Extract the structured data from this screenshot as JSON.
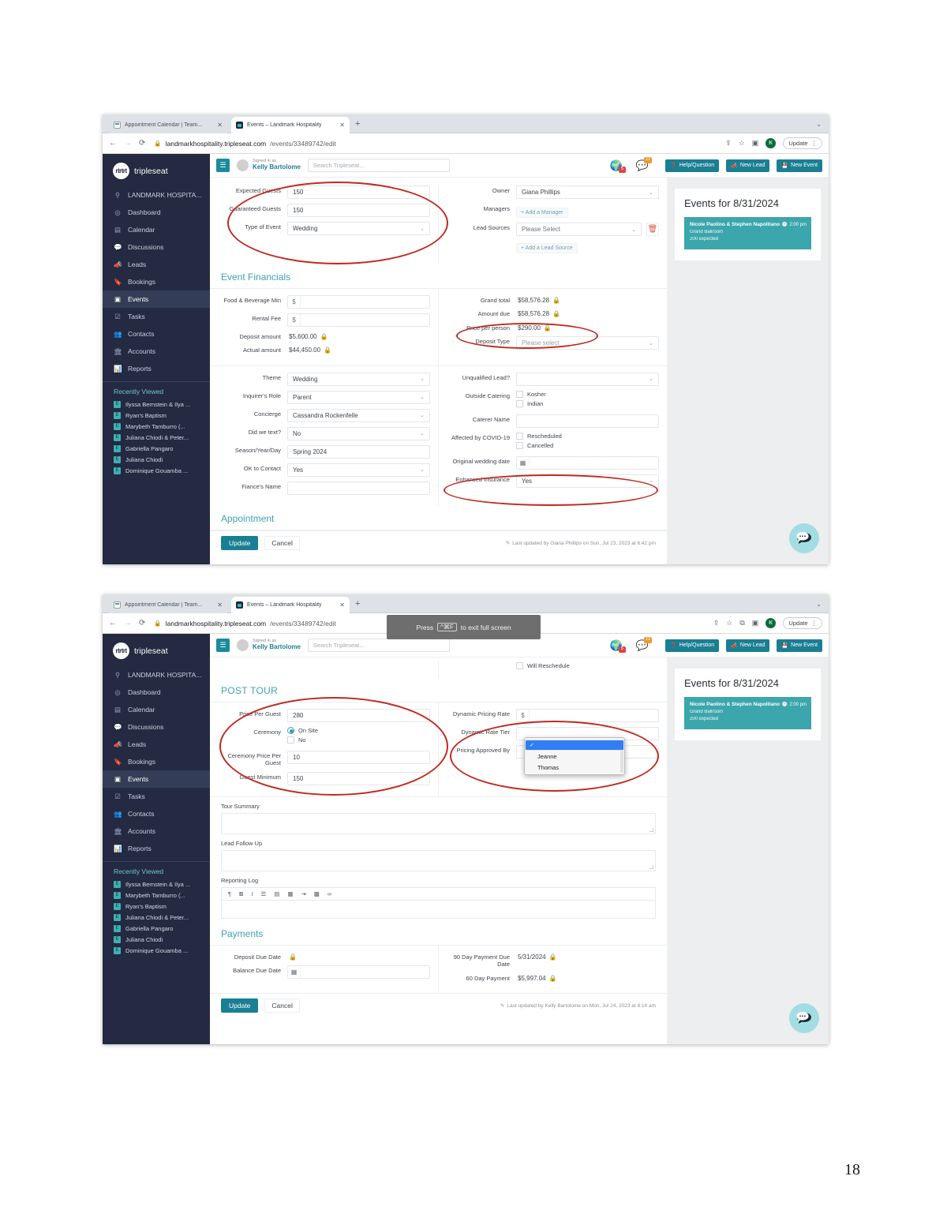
{
  "page": {
    "number": "18"
  },
  "browser": {
    "tabs": [
      {
        "label": "Appointment Calendar | Team...",
        "close": "✕",
        "icon": "calendar-favicon"
      },
      {
        "label": "Events – Landmark Hospitality",
        "close": "✕",
        "icon": "tripleseat-favicon"
      }
    ],
    "new_tab": "+",
    "back": "←",
    "forward": "→",
    "reload": "⟳",
    "lock": "🔒",
    "url_host": "landmarkhospitality.tripleseat.com",
    "url_path": "/events/33489742/edit",
    "toolbar": {
      "share": "⇪",
      "bookmark": "☆",
      "sidepanel": "▣",
      "profile_initial": "K",
      "update_label": "Update",
      "kebab": "⋮"
    },
    "fullscreen_toast": {
      "pre": "Press",
      "key": "^⌘F",
      "post": "to exit full screen"
    }
  },
  "app": {
    "brand": {
      "mark": "rtrtrt",
      "name": "tripleseat"
    },
    "header": {
      "menu_icon": "☰",
      "signed_in_label": "Signed in as",
      "user_name": "Kelly Bartolome",
      "search_placeholder": "Search Tripleseat...",
      "globe_badge": "5",
      "chat_badge": "12",
      "buttons": [
        {
          "label": "Help/Question",
          "icon": "question-circle"
        },
        {
          "label": "New Lead",
          "icon": "megaphone"
        },
        {
          "label": "New Event",
          "icon": "save-disk"
        }
      ]
    },
    "sidebar": {
      "items": [
        {
          "label": "LANDMARK HOSPITA...",
          "icon": "location-pin",
          "active": false
        },
        {
          "label": "Dashboard",
          "icon": "gauge",
          "active": false
        },
        {
          "label": "Calendar",
          "icon": "calendar",
          "active": false
        },
        {
          "label": "Discussions",
          "icon": "chat",
          "active": false
        },
        {
          "label": "Leads",
          "icon": "megaphone",
          "active": false
        },
        {
          "label": "Bookings",
          "icon": "bookmark",
          "active": false
        },
        {
          "label": "Events",
          "icon": "event-card",
          "active": true
        },
        {
          "label": "Tasks",
          "icon": "check-square",
          "active": false
        },
        {
          "label": "Contacts",
          "icon": "people",
          "active": false
        },
        {
          "label": "Accounts",
          "icon": "building",
          "active": false
        },
        {
          "label": "Reports",
          "icon": "bar-chart",
          "active": false
        }
      ],
      "recently_viewed_title": "Recently Viewed",
      "recent_1": [
        "Ilyssa Bernstein & Ilya ...",
        "Ryan's Baptism",
        "Marybeth Tamburro (...",
        "Juliana Chiodi & Peter...",
        "Gabriella Pangaro",
        "Juliana Chiodi",
        "Dominique Gouamba ..."
      ],
      "recent_2": [
        "Ilyssa Bernstein & Ilya ...",
        "Marybeth Tamburro (...",
        "Ryan's Baptism",
        "Juliana Chiodi & Peter...",
        "Gabriella Pangaro",
        "Juliana Chiodi",
        "Dominique Gouamba ..."
      ],
      "badge_letter": "E"
    },
    "right_panel": {
      "title": "Events for 8/31/2024",
      "event": {
        "name": "Nicole Paolino & Stephen Napolitano",
        "room": "Grand Ballroom",
        "expected": "200 expected",
        "time": "2:00 pm",
        "clock_icon": "🕐"
      }
    },
    "footer": {
      "update": "Update",
      "cancel": "Cancel",
      "last_updated_1": "Last updated by Giana Phillips on Sun, Jul 23, 2023 at 6:42 pm",
      "last_updated_2": "Last updated by Kelly Bartolome on Mon, Jul 24, 2023 at 8:14 am",
      "pencil_icon": "✎"
    }
  },
  "shot1": {
    "guests": {
      "expected_label": "Expected Guests",
      "expected_value": "150",
      "guaranteed_label": "Guaranteed Guests",
      "guaranteed_value": "150",
      "type_label": "Type of Event",
      "type_value": "Wedding"
    },
    "owner": {
      "owner_label": "Owner",
      "owner_value": "Giana Phillips",
      "managers_label": "Managers",
      "add_manager": "+ Add a Manager",
      "lead_sources_label": "Lead Sources",
      "lead_source_value": "Please Select",
      "add_lead_source": "+ Add a Lead Source",
      "delete_icon": "🗑"
    },
    "financials_title": "Event Financials",
    "financials_left": [
      {
        "label": "Food & Beverage Min",
        "type": "money-input",
        "prefix": "$",
        "value": ""
      },
      {
        "label": "Rental Fee",
        "type": "money-input",
        "prefix": "$",
        "value": ""
      },
      {
        "label": "Deposit amount",
        "type": "locked",
        "value": "$5,600.00"
      },
      {
        "label": "Actual amount",
        "type": "locked",
        "value": "$44,450.00"
      }
    ],
    "financials_right": [
      {
        "label": "Grand total",
        "type": "locked",
        "value": "$58,576.28"
      },
      {
        "label": "Amount due",
        "type": "locked",
        "value": "$58,576.28"
      },
      {
        "label": "Price per person",
        "type": "locked",
        "value": "$290.00"
      },
      {
        "label": "Deposit Type",
        "type": "select",
        "value": "Please select"
      }
    ],
    "details_left": [
      {
        "label": "Theme",
        "type": "select",
        "value": "Wedding"
      },
      {
        "label": "Inquirer's Role",
        "type": "select",
        "value": "Parent"
      },
      {
        "label": "Concierge",
        "type": "select",
        "value": "Cassandra Rockenfelle"
      },
      {
        "label": "Did we text?",
        "type": "select",
        "value": "No"
      },
      {
        "label": "Season/Year/Day",
        "type": "input",
        "value": "Spring 2024"
      },
      {
        "label": "OK to Contact",
        "type": "select",
        "value": "Yes"
      },
      {
        "label": "Fiance's Name",
        "type": "input",
        "value": ""
      }
    ],
    "details_right": {
      "unqualified_label": "Unqualified Lead?",
      "unqualified_value": "",
      "outside_catering_label": "Outside Catering",
      "outside_catering_options": [
        "Kosher",
        "Indian"
      ],
      "caterer_label": "Caterer Name",
      "caterer_value": "",
      "covid_label": "Affected by COVID-19",
      "covid_options": [
        "Rescheduled",
        "Cancelled"
      ],
      "orig_date_label": "Original wedding date",
      "orig_date_value": "",
      "insurance_label": "Enhanced Insurance",
      "insurance_value": "Yes"
    },
    "appointment_title": "Appointment"
  },
  "shot2": {
    "will_reschedule": "Will Reschedule",
    "post_tour_title": "POST TOUR",
    "post_tour_left": {
      "price_label": "Price Per Guest",
      "price_value": "280",
      "ceremony_label": "Ceremony",
      "ceremony_options": [
        {
          "label": "On Site",
          "selected": true
        },
        {
          "label": "No",
          "selected": false
        }
      ],
      "ceremony_price_label": "Ceremony Price Per Guest",
      "ceremony_price_value": "10",
      "guest_min_label": "Guest Minimum",
      "guest_min_value": "150"
    },
    "post_tour_right": {
      "dynamic_rate_label": "Dynamic Pricing Rate",
      "dynamic_rate_prefix": "$",
      "dynamic_rate_value": "",
      "dynamic_tier_label": "Dynamic Rate Tier",
      "dynamic_tier_value": "",
      "approved_label": "Pricing Approved By",
      "approved_options": [
        "",
        "Jeanne",
        "Thomas"
      ],
      "approved_selected": ""
    },
    "tour_summary_label": "Tour Summary",
    "tour_summary_value": "",
    "lead_follow_label": "Lead Follow Up",
    "lead_follow_value": "",
    "reporting_log_label": "Reporting Log",
    "rte_tools": [
      "¶",
      "B",
      "I",
      "☰",
      "▤",
      "▦",
      "⇥",
      "▩",
      "∞"
    ],
    "payments_title": "Payments",
    "payments_left": [
      {
        "label": "Deposit Due Date",
        "type": "locked-empty",
        "value": ""
      },
      {
        "label": "Balance Due Date",
        "type": "date",
        "value": ""
      }
    ],
    "payments_right": [
      {
        "label": "90 Day Payment Due Date",
        "type": "locked",
        "value": "5/31/2024"
      },
      {
        "label": "60 Day Payment",
        "type": "locked",
        "value": "$5,997.04"
      }
    ]
  },
  "colors": {
    "teal": "#1a7f93",
    "sidebar": "#232a41",
    "annotation_red": "#c02a20",
    "event_block": "#3ba6ac"
  }
}
